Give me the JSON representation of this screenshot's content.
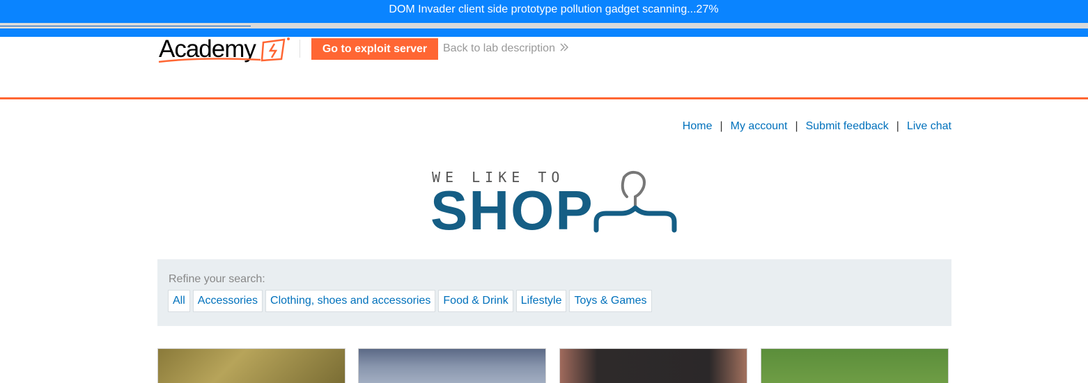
{
  "scanner": {
    "text": "DOM Invader client side prototype pollution gadget scanning...27%",
    "progress_percent": 27
  },
  "academy_header": {
    "logo_text": "Academy",
    "exploit_button": "Go to exploit server",
    "back_link": "Back to lab description",
    "accent_color": "#ff6633"
  },
  "nav": {
    "home": "Home",
    "my_account": "My account",
    "submit_feedback": "Submit feedback",
    "live_chat": "Live chat",
    "separator": "|"
  },
  "shop_logo": {
    "tagline": "WE LIKE TO",
    "word": "SHOP",
    "brand_color": "#155e85"
  },
  "filter": {
    "label": "Refine your search:",
    "categories": [
      "All",
      "Accessories",
      "Clothing, shoes and accessories",
      "Food & Drink",
      "Lifestyle",
      "Toys & Games"
    ]
  },
  "colors": {
    "banner": "#0a84ff",
    "link": "#0071bc",
    "filter_bg": "#e9eef1"
  }
}
